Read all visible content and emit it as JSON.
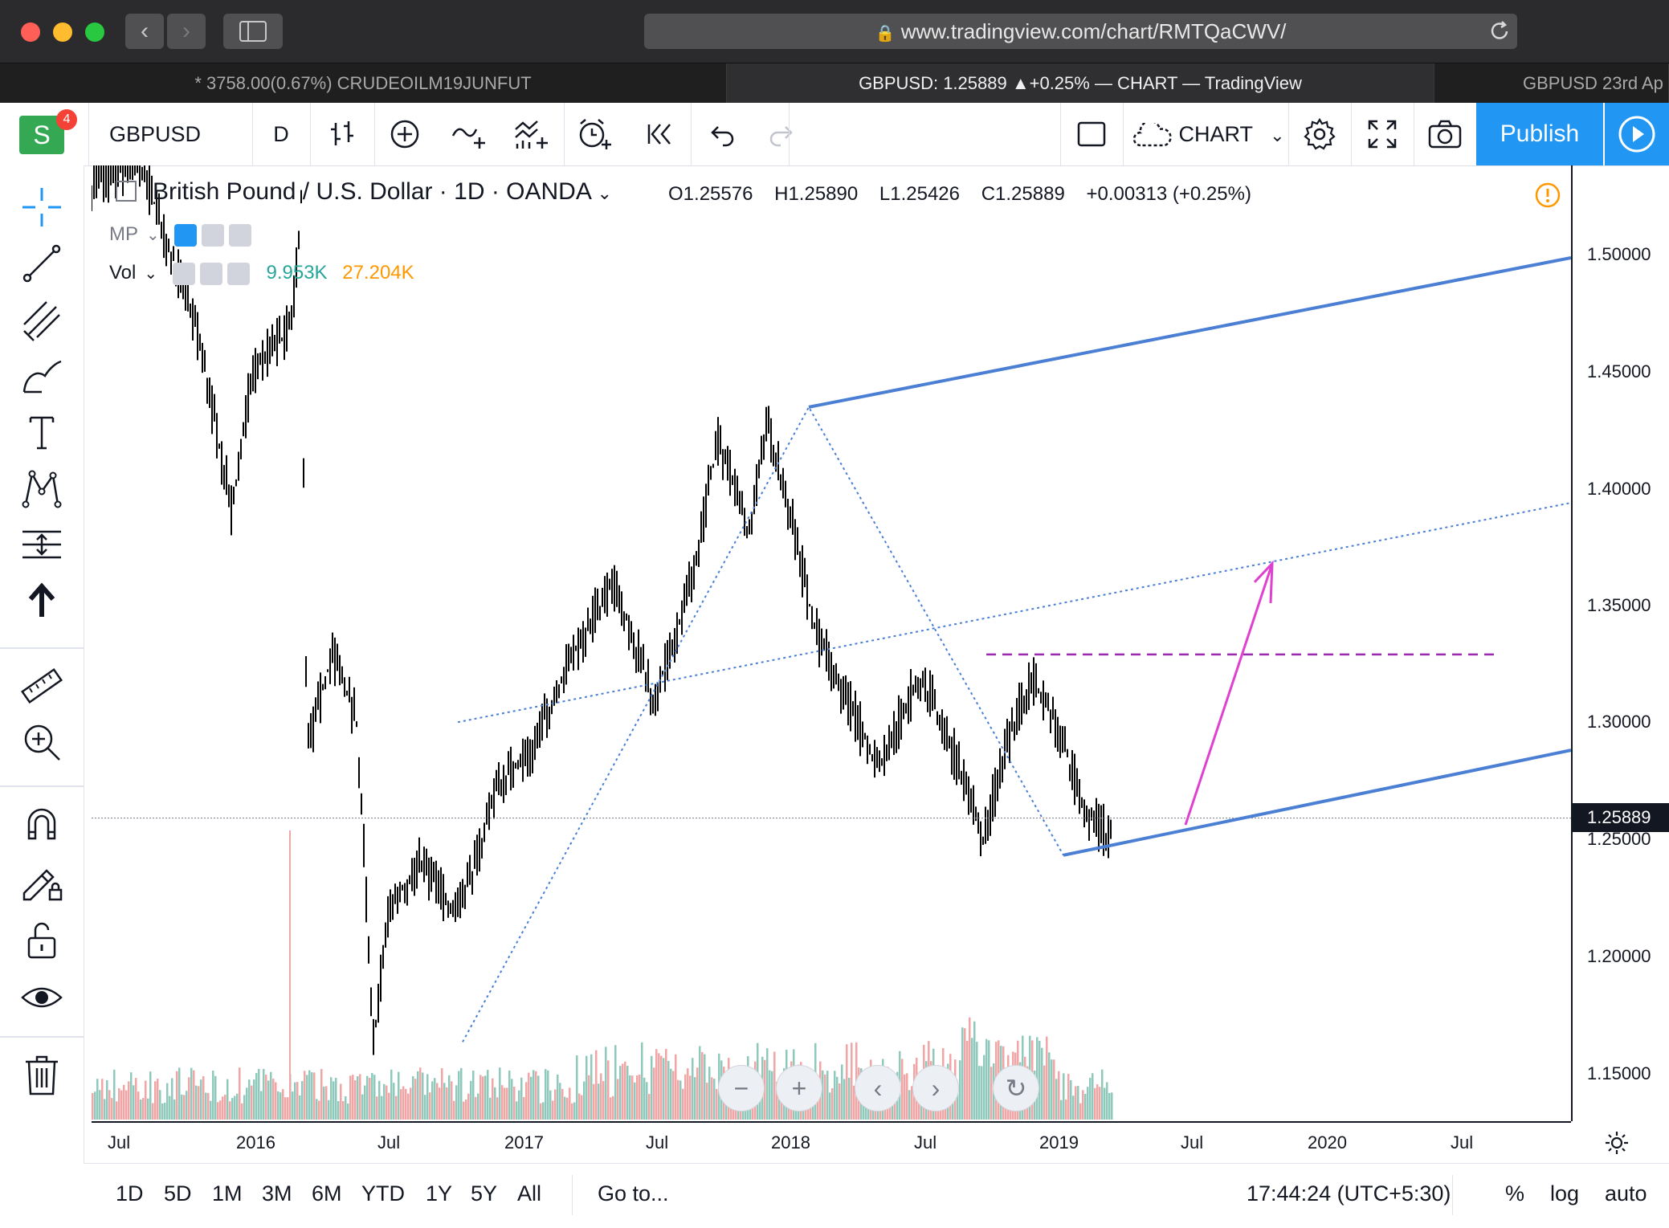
{
  "browser": {
    "url": "www.tradingview.com/chart/RMTQaCWV/",
    "tabs": [
      {
        "label": "* 3758.00(0.67%) CRUDEOILM19JUNFUT"
      },
      {
        "label": "GBPUSD: 1.25889 ▲+0.25% — CHART — TradingView"
      },
      {
        "label": "GBPUSD 23rd Ap"
      }
    ],
    "back_glyph": "‹",
    "forward_glyph": "›"
  },
  "toolbar": {
    "avatar_letter": "S",
    "notification_count": "4",
    "symbol": "GBPUSD",
    "interval": "D",
    "layout_label": "CHART",
    "publish_label": "Publish"
  },
  "legend": {
    "title": "British Pound / U.S. Dollar · 1D · OANDA",
    "open_label": "O",
    "open": "1.25576",
    "high_label": "H",
    "high": "1.25890",
    "low_label": "L",
    "low": "1.25426",
    "close_label": "C",
    "close": "1.25889",
    "change": "+0.00313 (+0.25%)",
    "mp_label": "MP",
    "vol_label": "Vol",
    "vol_value1": "9.953K",
    "vol_value2": "27.204K"
  },
  "price_axis": {
    "labels": [
      "1.50000",
      "1.45000",
      "1.40000",
      "1.35000",
      "1.30000",
      "1.25000",
      "1.20000",
      "1.15000"
    ],
    "current_price": "1.25889"
  },
  "time_axis": {
    "labels": [
      "Jul",
      "2016",
      "Jul",
      "2017",
      "Jul",
      "2018",
      "Jul",
      "2019",
      "Jul",
      "2020",
      "Jul"
    ]
  },
  "bottom_bar": {
    "ranges": [
      "1D",
      "5D",
      "1M",
      "3M",
      "6M",
      "YTD",
      "1Y",
      "5Y",
      "All"
    ],
    "goto_label": "Go to...",
    "clock": "17:44:24 (UTC+5:30)",
    "percent_label": "%",
    "log_label": "log",
    "auto_label": "auto"
  },
  "colors": {
    "accent": "#2196f3",
    "channel_line": "#4a7fd4",
    "arrow": "#e040d0",
    "dashed_level": "#9c27b0",
    "volume_up": "#8fc9bc",
    "volume_down": "#f2a5a5"
  }
}
